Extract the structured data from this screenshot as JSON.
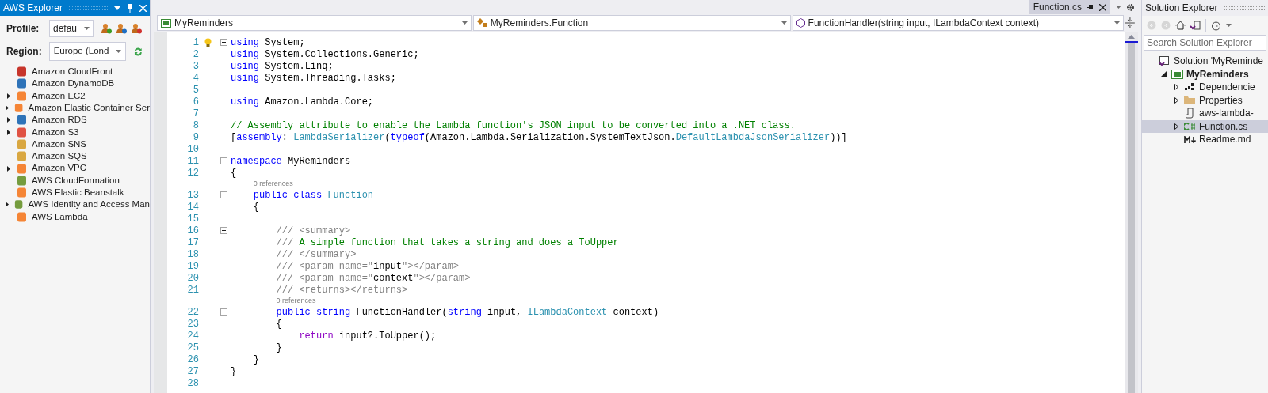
{
  "aws_explorer": {
    "title": "AWS Explorer",
    "profile": {
      "label": "Profile:",
      "value": "defau"
    },
    "region": {
      "label": "Region:",
      "value": "Europe (Lond"
    },
    "services": [
      {
        "label": "Amazon CloudFront",
        "expandable": false,
        "color": "#c7352b"
      },
      {
        "label": "Amazon DynamoDB",
        "expandable": false,
        "color": "#2e73b8"
      },
      {
        "label": "Amazon EC2",
        "expandable": true,
        "color": "#f58536"
      },
      {
        "label": "Amazon Elastic Container Ser",
        "expandable": true,
        "color": "#f58536"
      },
      {
        "label": "Amazon RDS",
        "expandable": true,
        "color": "#2e73b8"
      },
      {
        "label": "Amazon S3",
        "expandable": true,
        "color": "#e05243"
      },
      {
        "label": "Amazon SNS",
        "expandable": false,
        "color": "#d9a741"
      },
      {
        "label": "Amazon SQS",
        "expandable": false,
        "color": "#d9a741"
      },
      {
        "label": "Amazon VPC",
        "expandable": true,
        "color": "#f58536"
      },
      {
        "label": "AWS CloudFormation",
        "expandable": false,
        "color": "#759c3e"
      },
      {
        "label": "AWS Elastic Beanstalk",
        "expandable": false,
        "color": "#f58536"
      },
      {
        "label": "AWS Identity and Access Man",
        "expandable": true,
        "color": "#759c3e"
      },
      {
        "label": "AWS Lambda",
        "expandable": false,
        "color": "#f58536"
      }
    ]
  },
  "editor": {
    "tab": "Function.cs",
    "nav": [
      "MyReminders",
      "MyReminders.Function",
      "FunctionHandler(string input, ILambdaContext context)"
    ],
    "lines": [
      {
        "number": "1",
        "fold": true,
        "tokens": [
          {
            "kind": "keyword",
            "text": "using"
          },
          {
            "kind": "plain",
            "text": " System;"
          }
        ]
      },
      {
        "number": "2",
        "fold": false,
        "tokens": [
          {
            "kind": "keyword",
            "text": "using"
          },
          {
            "kind": "plain",
            "text": " System.Collections.Generic;"
          }
        ]
      },
      {
        "number": "3",
        "fold": false,
        "tokens": [
          {
            "kind": "keyword",
            "text": "using"
          },
          {
            "kind": "plain",
            "text": " System.Linq;"
          }
        ]
      },
      {
        "number": "4",
        "fold": false,
        "tokens": [
          {
            "kind": "keyword",
            "text": "using"
          },
          {
            "kind": "plain",
            "text": " System.Threading.Tasks;"
          }
        ]
      },
      {
        "number": "5",
        "fold": false
      },
      {
        "number": "6",
        "fold": false,
        "tokens": [
          {
            "kind": "keyword",
            "text": "using"
          },
          {
            "kind": "plain",
            "text": " Amazon.Lambda.Core;"
          }
        ]
      },
      {
        "number": "7",
        "fold": false
      },
      {
        "number": "8",
        "fold": false,
        "tokens": [
          {
            "kind": "comment",
            "text": "// Assembly attribute to enable the Lambda function's JSON input to be converted into a .NET class."
          }
        ]
      },
      {
        "number": "9",
        "fold": false,
        "tokens": [
          {
            "kind": "plain",
            "text": "["
          },
          {
            "kind": "keyword",
            "text": "assembly"
          },
          {
            "kind": "plain",
            "text": ": "
          },
          {
            "kind": "type",
            "text": "LambdaSerializer"
          },
          {
            "kind": "plain",
            "text": "("
          },
          {
            "kind": "keyword",
            "text": "typeof"
          },
          {
            "kind": "plain",
            "text": "(Amazon.Lambda.Serialization.SystemTextJson."
          },
          {
            "kind": "type",
            "text": "DefaultLambdaJsonSerializer"
          },
          {
            "kind": "plain",
            "text": "))]"
          }
        ]
      },
      {
        "number": "10",
        "fold": false
      },
      {
        "number": "11",
        "fold": true,
        "tokens": [
          {
            "kind": "keyword",
            "text": "namespace"
          },
          {
            "kind": "plain",
            "text": " MyReminders"
          }
        ]
      },
      {
        "number": "12",
        "fold": false,
        "tokens": [
          {
            "kind": "plain",
            "text": "{"
          }
        ]
      },
      {
        "number": "13",
        "fold": true,
        "references": "0 references",
        "tokens": [
          {
            "kind": "keyword",
            "text": "    public class"
          },
          {
            "kind": "type",
            "text": " Function"
          }
        ]
      },
      {
        "number": "14",
        "fold": false,
        "tokens": [
          {
            "kind": "plain",
            "text": "    {"
          }
        ]
      },
      {
        "number": "15",
        "fold": false
      },
      {
        "number": "16",
        "fold": true,
        "tokens": [
          {
            "kind": "doc",
            "text": "        /// <summary>"
          }
        ]
      },
      {
        "number": "17",
        "fold": false,
        "tokens": [
          {
            "kind": "doc",
            "text": "        /// "
          },
          {
            "kind": "comment",
            "text": "A simple function that takes a string and does a ToUpper"
          }
        ]
      },
      {
        "number": "18",
        "fold": false,
        "tokens": [
          {
            "kind": "doc",
            "text": "        /// </summary>"
          }
        ]
      },
      {
        "number": "19",
        "fold": false,
        "tokens": [
          {
            "kind": "doc",
            "text": "        /// <param name=\""
          },
          {
            "kind": "plain",
            "text": "input"
          },
          {
            "kind": "doc",
            "text": "\"></param>"
          }
        ]
      },
      {
        "number": "20",
        "fold": false,
        "tokens": [
          {
            "kind": "doc",
            "text": "        /// <param name=\""
          },
          {
            "kind": "plain",
            "text": "context"
          },
          {
            "kind": "doc",
            "text": "\"></param>"
          }
        ]
      },
      {
        "number": "21",
        "fold": false,
        "tokens": [
          {
            "kind": "doc",
            "text": "        /// <returns></returns>"
          }
        ]
      },
      {
        "number": "22",
        "fold": true,
        "references": "0 references",
        "tokens": [
          {
            "kind": "keyword",
            "text": "        public string"
          },
          {
            "kind": "plain",
            "text": " FunctionHandler("
          },
          {
            "kind": "keyword",
            "text": "string"
          },
          {
            "kind": "plain",
            "text": " input, "
          },
          {
            "kind": "type",
            "text": "ILambdaContext"
          },
          {
            "kind": "plain",
            "text": " context)"
          }
        ]
      },
      {
        "number": "23",
        "fold": false,
        "tokens": [
          {
            "kind": "plain",
            "text": "        {"
          }
        ]
      },
      {
        "number": "24",
        "fold": false,
        "tokens": [
          {
            "kind": "control",
            "text": "            return"
          },
          {
            "kind": "plain",
            "text": " input?.ToUpper();"
          }
        ]
      },
      {
        "number": "25",
        "fold": false,
        "tokens": [
          {
            "kind": "plain",
            "text": "        }"
          }
        ]
      },
      {
        "number": "26",
        "fold": false,
        "tokens": [
          {
            "kind": "plain",
            "text": "    }"
          }
        ]
      },
      {
        "number": "27",
        "fold": false,
        "tokens": [
          {
            "kind": "plain",
            "text": "}"
          }
        ]
      },
      {
        "number": "28",
        "fold": false
      }
    ]
  },
  "solution_explorer": {
    "title": "Solution Explorer",
    "search": {
      "placeholder": "Search Solution Explorer"
    },
    "tree": [
      {
        "label": "Solution 'MyReminde",
        "kind": "solution",
        "selected": false,
        "children": [
          {
            "label": "MyReminders",
            "kind": "project",
            "expanded": true,
            "selected": false,
            "children": [
              {
                "label": "Dependencie",
                "kind": "dependencies",
                "expanded": false,
                "selected": false
              },
              {
                "label": "Properties",
                "kind": "folder",
                "expanded": false,
                "selected": false
              },
              {
                "label": "aws-lambda-",
                "kind": "json",
                "selected": false
              },
              {
                "label": "Function.cs",
                "kind": "csharp",
                "expanded": false,
                "selected": true
              },
              {
                "label": "Readme.md",
                "kind": "markdown",
                "selected": false
              }
            ]
          }
        ]
      }
    ]
  }
}
